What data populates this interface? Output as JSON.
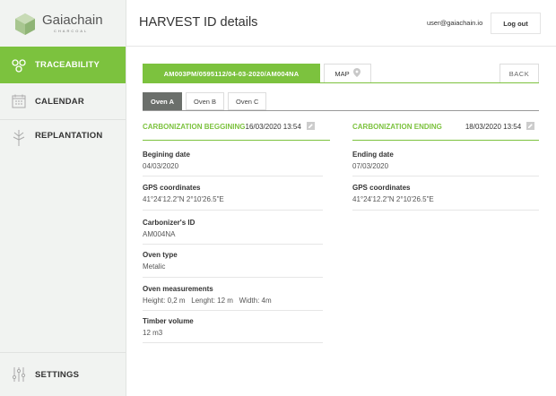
{
  "brand": {
    "name": "Gaiachain",
    "sub": "CHARCOAL"
  },
  "sidebar": {
    "items": [
      {
        "label": "TRACEABILITY",
        "icon": "traceability-icon"
      },
      {
        "label": "CALENDAR",
        "icon": "calendar-icon"
      },
      {
        "label": "REPLANTATION",
        "icon": "tree-icon"
      }
    ],
    "settings": {
      "label": "SETTINGS",
      "icon": "sliders-icon"
    }
  },
  "header": {
    "title": "HARVEST ID details",
    "user_email": "user@gaiachain.io",
    "logout_label": "Log out"
  },
  "idbar": {
    "harvest_id": "AM003PM/0595112/04-03-2020/AM004NA",
    "map_label": "MAP",
    "back_label": "BACK"
  },
  "tabs": [
    "Oven A",
    "Oven B",
    "Oven C"
  ],
  "active_tab": "Oven A",
  "carbonization_begin": {
    "title": "CARBONIZATION BEGGINING",
    "datetime": "16/03/2020 13:54",
    "fields": [
      {
        "label": "Begining date",
        "value": "04/03/2020"
      },
      {
        "label": "GPS coordinates",
        "value": "41°24'12.2\"N 2°10'26.5\"E"
      },
      {
        "label": "Carbonizer's ID",
        "value": "AM004NA"
      },
      {
        "label": "Oven type",
        "value": "Metalic"
      },
      {
        "label": "Oven measurements",
        "value": "Height: 0,2 m   Lenght: 12 m   Width: 4m"
      },
      {
        "label": "Timber volume",
        "value": "12 m3"
      }
    ]
  },
  "carbonization_end": {
    "title": "CARBONIZATION ENDING",
    "datetime": "18/03/2020 13:54",
    "fields": [
      {
        "label": "Ending date",
        "value": "07/03/2020"
      },
      {
        "label": "GPS coordinates",
        "value": "41°24'12.2\"N 2°10'26.5\"E"
      }
    ]
  },
  "colors": {
    "accent": "#7cc23e",
    "tab_active": "#6b6f6b",
    "sidebar_bg": "#f1f3f1"
  }
}
